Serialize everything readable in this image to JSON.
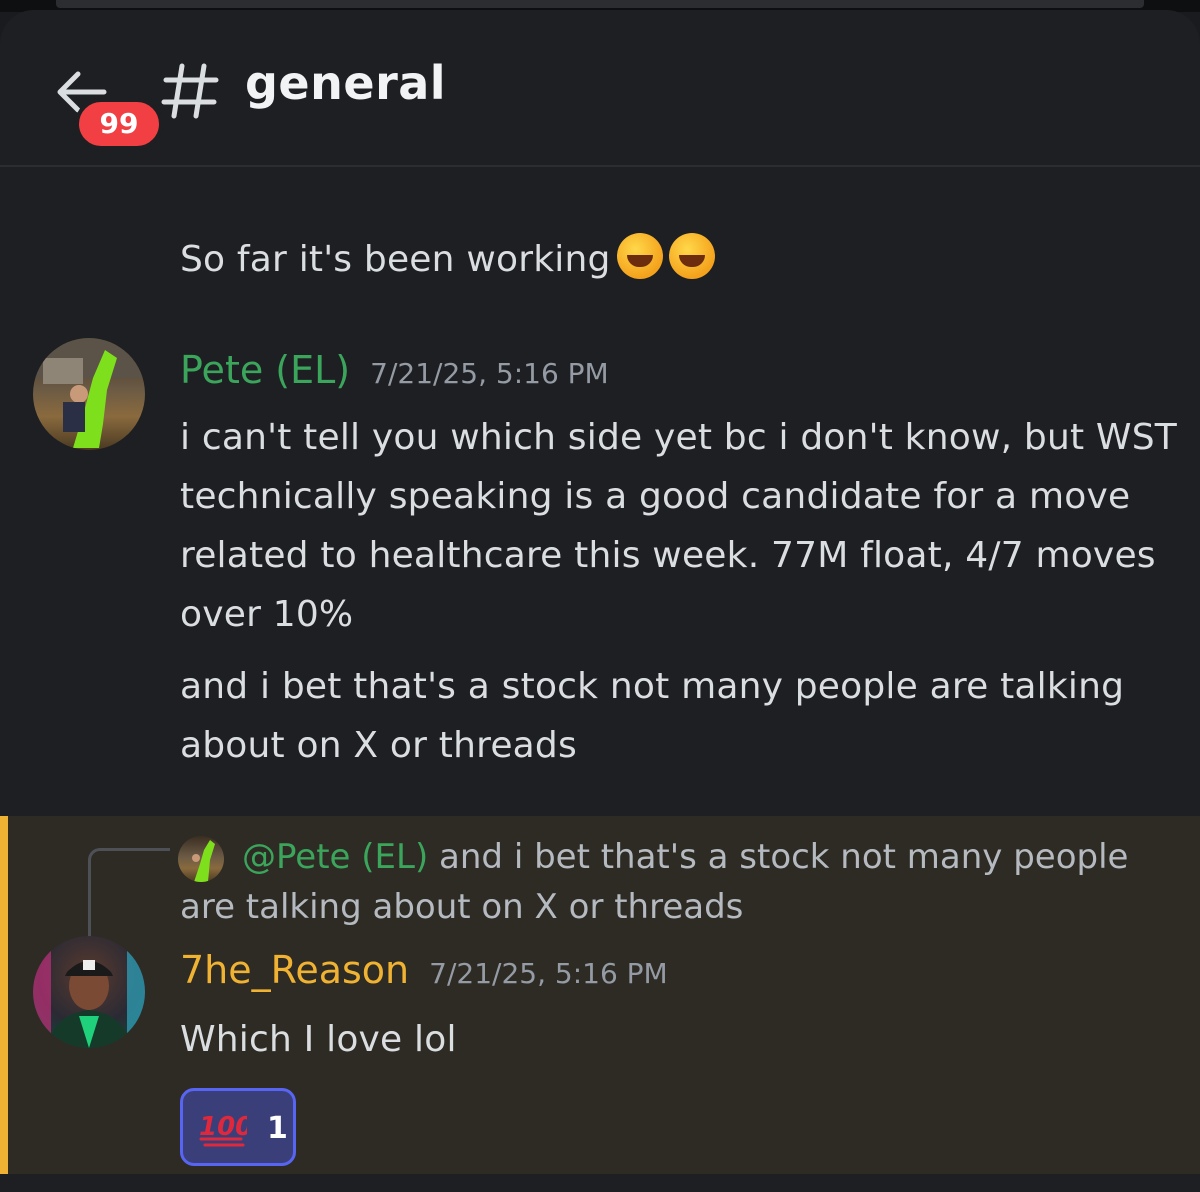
{
  "header": {
    "channel_name": "general",
    "unread_badge": "99"
  },
  "messages": {
    "previous_text": "So far it's been working",
    "pete": {
      "username": "Pete (EL)",
      "timestamp": "7/21/25, 5:16 PM",
      "paragraph_1": "i can't tell you which side yet bc i don't know, but WST technically speaking is a good candidate for a move related to healthcare this week. 77M float, 4/7 moves over 10%",
      "paragraph_2": "and i bet that's a stock not many people are talking about on X or threads"
    },
    "reason": {
      "reply_mention": "@Pete (EL)",
      "reply_preview": "and i bet that's a stock not many people are talking about on X or threads",
      "username": "7he_Reason",
      "timestamp": "7/21/25, 5:16 PM",
      "text": "Which I love lol",
      "reaction_count": "1"
    }
  },
  "icons": [
    "back-arrow-icon",
    "hash-icon",
    "rofl-emoji",
    "hundred-points-emoji"
  ],
  "colors": {
    "background": "#1e1f22",
    "pete_name": "#3ba55c",
    "reason_name": "#f0b232",
    "highlight_border": "#f0b232",
    "badge": "#f23f43"
  }
}
